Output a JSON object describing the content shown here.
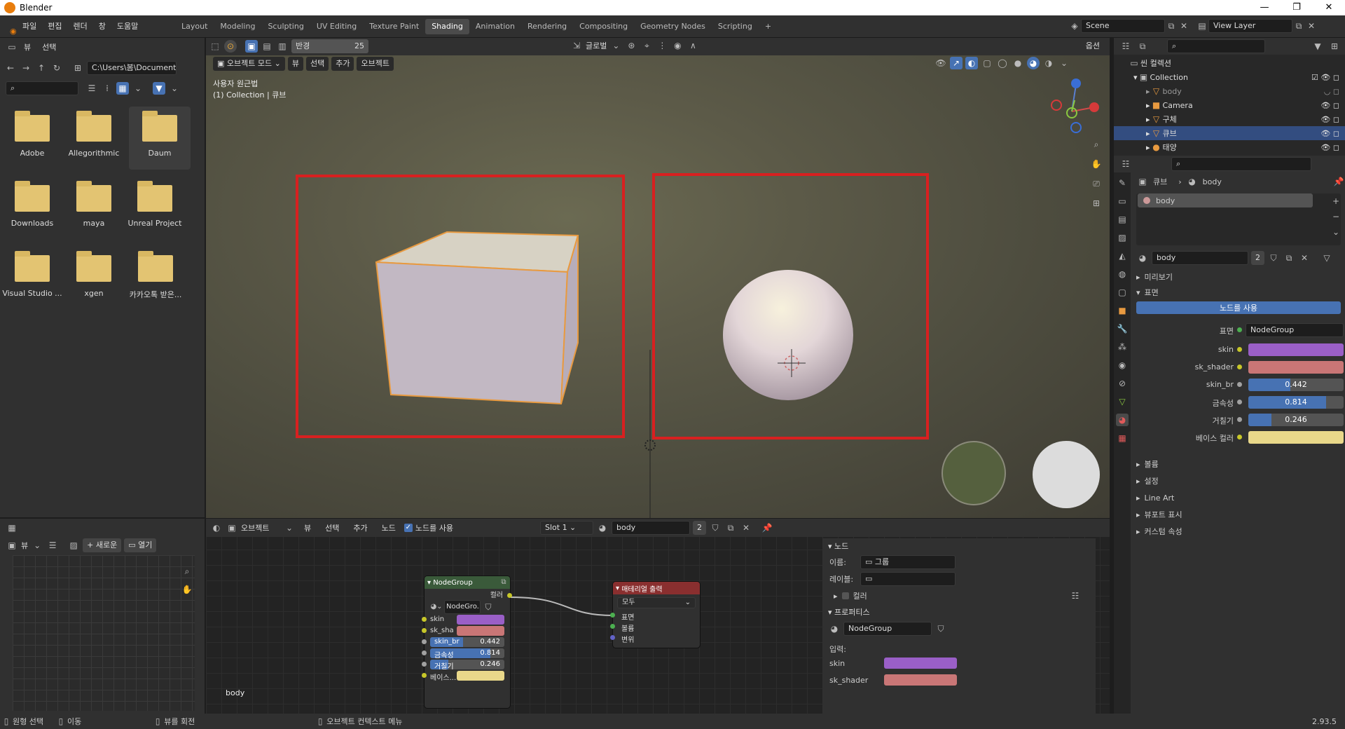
{
  "window": {
    "title": "Blender",
    "min": "—",
    "max": "❐",
    "close": "✕"
  },
  "menu": [
    "파일",
    "편집",
    "렌더",
    "창",
    "도움말"
  ],
  "workspaces": [
    "Layout",
    "Modeling",
    "Sculpting",
    "UV Editing",
    "Texture Paint",
    "Shading",
    "Animation",
    "Rendering",
    "Compositing",
    "Geometry Nodes",
    "Scripting"
  ],
  "scene": "Scene",
  "view_layer": "View Layer",
  "filebrowser": {
    "menu": [
      "뷰",
      "선택"
    ],
    "path": "C:\\Users\\봄\\Documents\\",
    "folders": [
      "Adobe",
      "Allegorithmic",
      "Daum",
      "Downloads",
      "maya",
      "Unreal Project",
      "Visual Studio ...",
      "xgen",
      "카카오톡 받은..."
    ]
  },
  "viewport_header": {
    "mode": "오브젝트 모드",
    "menus": [
      "뷰",
      "선택",
      "추가",
      "오브젝트"
    ],
    "radius_label": "반경",
    "radius_value": "25",
    "transform": "글로벌",
    "options": "옵션"
  },
  "viewport": {
    "line1": "사용자 원근법",
    "line2": "(1) Collection | 큐브"
  },
  "outliner": {
    "root": "씬 컬렉션",
    "collection": "Collection",
    "items": [
      "body",
      "Camera",
      "구체",
      "큐브",
      "태양"
    ]
  },
  "properties": {
    "breadcrumb_obj": "큐브",
    "breadcrumb_mat": "body",
    "slot_name": "body",
    "mat_field": "body",
    "users": "2",
    "sections": {
      "preview": "미리보기",
      "surface": "표면",
      "volume": "볼륨",
      "settings": "설정",
      "lineart": "Line Art",
      "viewport": "뷰포트 표시",
      "custom": "커스텀 속성"
    },
    "use_nodes": "노드를 사용",
    "surface_label": "표면",
    "surface_value": "NodeGroup",
    "inputs": [
      {
        "label": "skin",
        "type": "color",
        "color": "#9a5fc7"
      },
      {
        "label": "sk_shader",
        "type": "color",
        "color": "#c97676"
      },
      {
        "label": "skin_br",
        "type": "value",
        "value": "0.442",
        "frac": 0.442
      },
      {
        "label": "금속성",
        "type": "value",
        "value": "0.814",
        "frac": 0.814
      },
      {
        "label": "거칠기",
        "type": "value",
        "value": "0.246",
        "frac": 0.246
      },
      {
        "label": "베이스 컬러",
        "type": "color",
        "color": "#e9d88a"
      }
    ]
  },
  "image_editor": {
    "menu": "뷰",
    "new": "새로운",
    "open": "열기"
  },
  "node_header": {
    "object": "오브젝트",
    "menus": [
      "뷰",
      "선택",
      "추가",
      "노드"
    ],
    "use_nodes": "노드를 사용",
    "slot": "Slot 1",
    "material": "body",
    "users": "2"
  },
  "nodegroup": {
    "title": "NodeGroup",
    "out": "컬러",
    "group_field": "NodeGro...",
    "rows": [
      "skin",
      "sk_sha",
      "skin_br",
      "금속성",
      "거칠기",
      "베이스..."
    ],
    "vals": [
      "",
      "",
      "0.442",
      "0.814",
      "0.246",
      ""
    ]
  },
  "output_node": {
    "title": "매테리얼 출력",
    "target": "모두",
    "sockets": [
      "표면",
      "볼륨",
      "변위"
    ]
  },
  "node_label": "body",
  "sidebar": {
    "node_title": "노드",
    "name_label": "이름:",
    "name_value": "그룹",
    "label_label": "레이블:",
    "color_label": "컬러",
    "props_title": "프로퍼티스",
    "group": "NodeGroup",
    "inputs_label": "입력:",
    "in1": "skin",
    "in2": "sk_shader"
  },
  "status": {
    "select": "원형 선택",
    "move": "이동",
    "rotate": "뷰를 회전",
    "context": "오브젝트 컨텍스트 메뉴",
    "version": "2.93.5"
  }
}
